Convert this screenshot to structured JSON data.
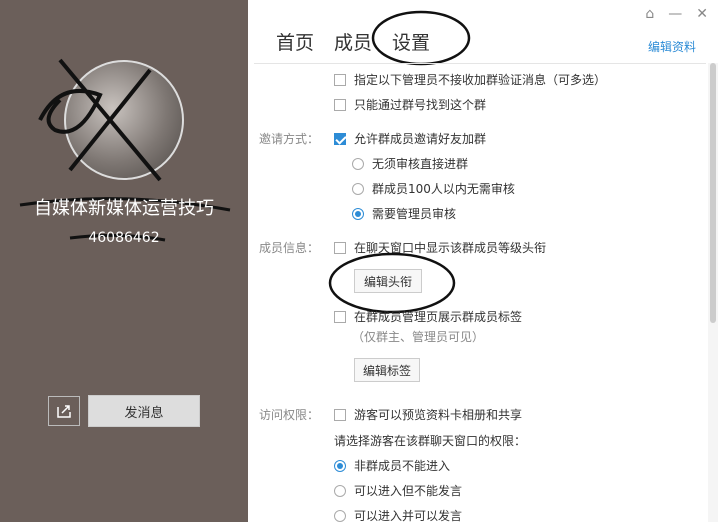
{
  "left_panel": {
    "group_name": "自媒体新媒体运营技巧",
    "group_id": "46086462",
    "send_message_label": "发消息",
    "share_icon": "share-icon"
  },
  "window": {
    "controls": [
      "⌂",
      "—",
      "✕"
    ]
  },
  "tabs": [
    {
      "label": "首页"
    },
    {
      "label": "成员"
    },
    {
      "label": "设置"
    }
  ],
  "edit_profile_label": "编辑资料",
  "settings": {
    "opt_no_verify_admins": "指定以下管理员不接收加群验证消息（可多选）",
    "opt_find_by_number_only": "只能通过群号找到这个群",
    "invite_label": "邀请方式：",
    "invite_allow": "允许群成员邀请好友加群",
    "invite_options": [
      "无须审核直接进群",
      "群成员100人以内无需审核",
      "需要管理员审核"
    ],
    "member_label": "成员信息：",
    "show_level_title": "在聊天窗口中显示该群成员等级头衔",
    "edit_title_button": "编辑头衔",
    "show_tags": "在群成员管理页展示群成员标签",
    "tags_note": "（仅群主、管理员可见）",
    "edit_tags_button": "编辑标签",
    "access_label": "访问权限：",
    "guest_preview": "游客可以预览资料卡相册和共享",
    "guest_prompt": "请选择游客在该群聊天窗口的权限：",
    "guest_options": [
      "非群成员不能进入",
      "可以进入但不能发言",
      "可以进入并可以发言"
    ]
  }
}
